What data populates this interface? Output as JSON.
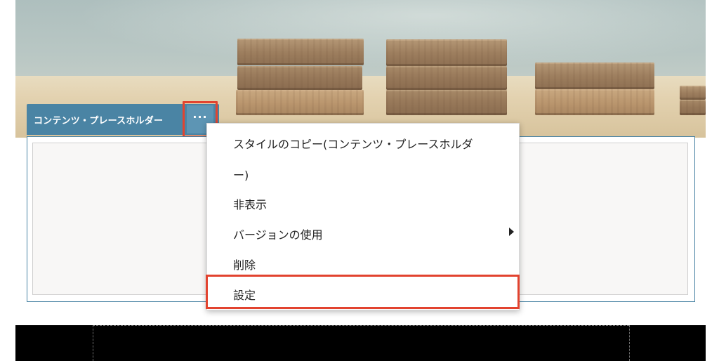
{
  "placeholder": {
    "label": "コンテンツ・プレースホルダー",
    "more_button_label": "···"
  },
  "context_menu": {
    "items": [
      {
        "label_line1": "スタイルのコピー(コンテンツ・プレースホルダ",
        "label_line2": "ー)"
      },
      {
        "label": "非表示"
      },
      {
        "label": "バージョンの使用",
        "has_submenu": true
      },
      {
        "label": "削除"
      },
      {
        "label": "設定",
        "highlighted": true
      }
    ]
  },
  "colors": {
    "toolbar_blue": "#4a84a4",
    "highlight_red": "#e2432f",
    "menu_text": "#222222"
  },
  "icons": {
    "more": "more-horizontal-icon",
    "submenu": "triangle-right-icon"
  }
}
